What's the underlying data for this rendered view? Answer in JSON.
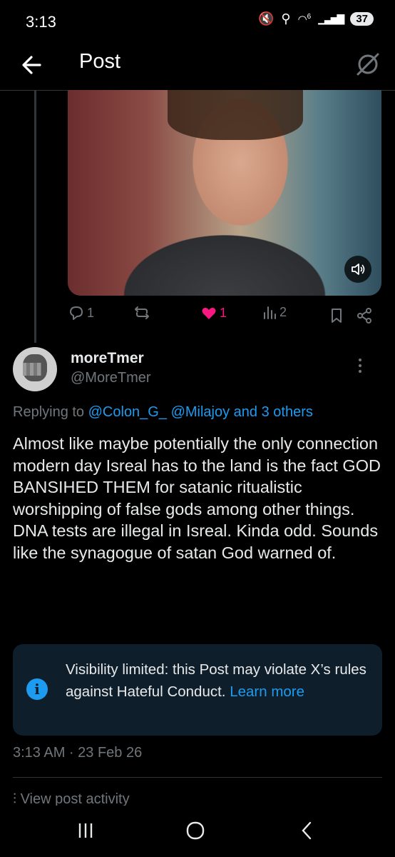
{
  "status_bar": {
    "time": "3:13",
    "battery": "37",
    "network": "6"
  },
  "topbar": {
    "title": "Post"
  },
  "media": {
    "type": "video"
  },
  "actions": {
    "replies": "1",
    "reposts": "",
    "likes": "1",
    "views": "2",
    "liked_color": "#f91880"
  },
  "author": {
    "name": "moreTmer",
    "handle": "@MoreTmer"
  },
  "replying": {
    "prefix": "Replying to",
    "user1": "@Colon_G_",
    "user2": "@Milajoy",
    "others": "and 3 others"
  },
  "post": {
    "text": "Almost like maybe potentially the only connection modern day Isreal has to the land is the fact GOD BANSIHED THEM for satanic ritualistic worshipping of false gods among other things. DNA tests are illegal in Isreal. Kinda odd. Sounds like the synagogue of satan God warned of."
  },
  "notice": {
    "text": "Visibility limited: this Post may violate X’s rules against Hateful Conduct.",
    "link": "Learn more"
  },
  "meta": {
    "timestamp": "3:13 AM · 23 Feb 26"
  },
  "activity": {
    "label": "View post activity"
  },
  "colors": {
    "accent": "#1d9bf0",
    "muted": "#71767b",
    "notice_bg": "#0f1e2b"
  }
}
